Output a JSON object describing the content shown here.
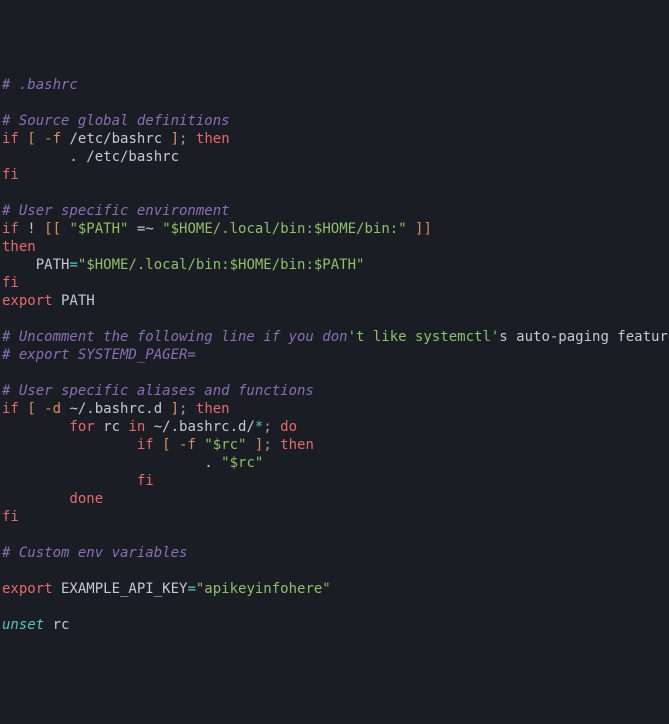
{
  "file": {
    "name": ".bashrc",
    "header_comment": "# .bashrc"
  },
  "sections": {
    "global_defs": {
      "comment": "# Source global definitions",
      "if": "if",
      "lb": "[",
      "flag": "-f",
      "path": " /etc/bashrc ",
      "rb": "]",
      "semi": ";",
      "then": " then",
      "source_cmd": "        . /etc/bashrc",
      "fi": "fi"
    },
    "user_env": {
      "comment": "# User specific environment",
      "if": "if",
      "bang": " ! ",
      "dblb": "[[ ",
      "path_var": "\"$PATH\"",
      "match": " =~ ",
      "pattern": "\"$HOME/.local/bin:$HOME/bin:\"",
      "dblr": " ]]",
      "then": "then",
      "assign_indent": "    PATH",
      "eq": "=",
      "assign_val": "\"$HOME/.local/bin:$HOME/bin:$PATH\"",
      "fi": "fi",
      "export": "export",
      "export_var": " PATH"
    },
    "systemd": {
      "comment1a": "# Uncomment the following line if you don",
      "comment1b": "'t like systemctl'",
      "comment1c": "s auto-paging feature:",
      "comment2": "# export SYSTEMD_PAGER="
    },
    "aliases": {
      "comment": "# User specific aliases and functions",
      "if": "if",
      "lb": " [ ",
      "flag": "-d",
      "path": " ~/.bashrc.d ",
      "rb": "]",
      "semi": ";",
      "then": " then",
      "for": "        for",
      "rc": " rc ",
      "in": "in",
      "glob_pre": " ~/.bashrc.d/",
      "glob_star": "*",
      "for_semi": ";",
      "do": " do",
      "inner_if": "                if",
      "inner_lb": " [ ",
      "inner_flag": "-f",
      "inner_var": " \"$rc\"",
      "inner_rb": " ]",
      "inner_semi": ";",
      "inner_then": " then",
      "source_line_indent": "                        . ",
      "source_var": "\"$rc\"",
      "inner_fi": "                fi",
      "done": "        done",
      "fi": "fi"
    },
    "custom": {
      "comment": "# Custom env variables",
      "export": "export",
      "var": " EXAMPLE_API_KEY",
      "eq": "=",
      "val": "\"apikeyinfohere\""
    },
    "cleanup": {
      "unset": "unset",
      "var": " rc"
    }
  }
}
